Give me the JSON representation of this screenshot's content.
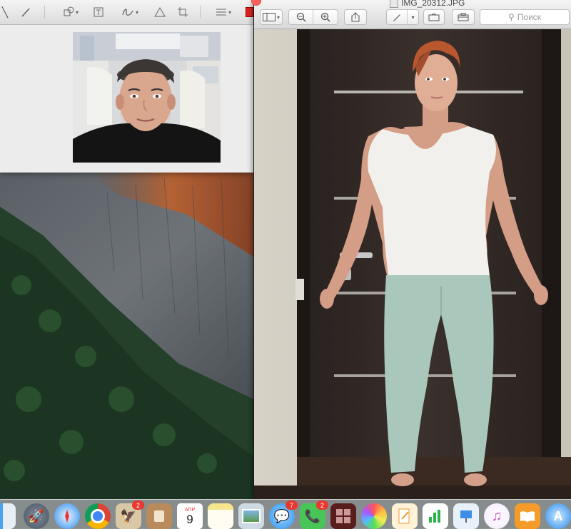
{
  "left_window": {
    "toolbar_icons": [
      "select-icon",
      "pen-icon",
      "shapes-icon",
      "text-icon",
      "signature-icon",
      "adjust-color-icon",
      "crop-icon",
      "align-icon"
    ]
  },
  "right_window": {
    "title": "IMG_20312.JPG",
    "search_placeholder": "Поиск",
    "toolbar_icons": [
      "sidebar-icon",
      "zoom-out-icon",
      "zoom-in-icon",
      "share-icon",
      "markup-icon",
      "rotate-icon",
      "toolbox-icon"
    ]
  },
  "dock": {
    "items": [
      {
        "name": "finder",
        "icon": "finder-icon",
        "badge": ""
      },
      {
        "name": "launchpad",
        "icon": "rocket-icon",
        "badge": ""
      },
      {
        "name": "safari",
        "icon": "compass-icon",
        "badge": ""
      },
      {
        "name": "chrome",
        "icon": "chrome-icon",
        "badge": ""
      },
      {
        "name": "mail-eagle",
        "icon": "eagle-stamp-icon",
        "badge": "2"
      },
      {
        "name": "contacts",
        "icon": "contacts-icon",
        "badge": ""
      },
      {
        "name": "calendar",
        "icon": "calendar-icon",
        "badge": "",
        "month": "АПР",
        "day": "9"
      },
      {
        "name": "notes",
        "icon": "notes-icon",
        "badge": ""
      },
      {
        "name": "preview",
        "icon": "preview-icon",
        "badge": ""
      },
      {
        "name": "messages",
        "icon": "messages-icon",
        "badge": "7"
      },
      {
        "name": "facetime",
        "icon": "facetime-icon",
        "badge": "2"
      },
      {
        "name": "photo-booth",
        "icon": "photo-booth-icon",
        "badge": ""
      },
      {
        "name": "photos",
        "icon": "photos-icon",
        "badge": ""
      },
      {
        "name": "pages",
        "icon": "pages-icon",
        "badge": ""
      },
      {
        "name": "numbers",
        "icon": "numbers-icon",
        "badge": ""
      },
      {
        "name": "keynote",
        "icon": "keynote-icon",
        "badge": ""
      },
      {
        "name": "itunes",
        "icon": "itunes-icon",
        "badge": ""
      },
      {
        "name": "ibooks",
        "icon": "ibooks-icon",
        "badge": ""
      },
      {
        "name": "app-store",
        "icon": "app-store-icon",
        "badge": ""
      }
    ]
  }
}
